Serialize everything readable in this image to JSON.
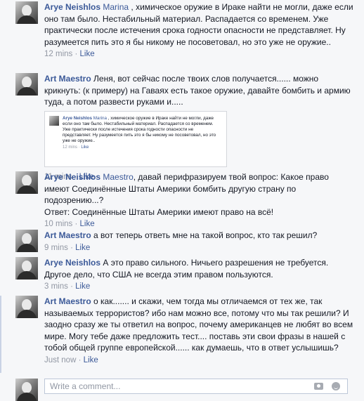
{
  "comments": [
    {
      "author": "Arye Neishlos",
      "mention": "Marina",
      "text": " , химическое оружие в Ираке найти не могли, даже если оно там было. Нестабильный материал. Распадается со временем. Уже практически после истечения срока годности опасности не представляет. Ну разумеется пить это я бы никому не посоветовал, но это уже не оружие..",
      "time": "12 mins",
      "like": "Like"
    },
    {
      "author": "Art Maestro",
      "mention": "",
      "text": " Леня, вот сейчас после твоих слов получается...... можно крикнуть: (к примеру) на Гаваях есть такое оружие, давайте бомбить и армию туда, а потом развести руками и.....",
      "time": "11 mins",
      "like": "Like",
      "attachment": {
        "author": "Arye Neishlos",
        "mention": "Marina",
        "text": " , химическое оружие в Ираке найти не могли, даже если оно там было. Нестабильный материал. Распадается со временем. Уже практически после истечения срока годности опасности не представляет. Ну разумеется пить это я бы никому не посоветовал, но это уже не оружие..",
        "time": "12 mins",
        "like": "Like"
      }
    },
    {
      "author": "Arye Neishlos",
      "mention": "Maestro",
      "text": ", давай перифразируем твой вопрос: Какое право имеют Соединённые Штаты Америки бомбить другую страну по подозрению...?",
      "text2": "Ответ: Соединённые Штаты Америки имеют право на всё!",
      "time": "10 mins",
      "like": "Like"
    },
    {
      "author": "Art Maestro",
      "mention": "",
      "text": " а вот теперь ответь мне на такой вопрос, кто так решил?",
      "time": "9 mins",
      "like": "Like"
    },
    {
      "author": "Arye Neishlos",
      "mention": "",
      "text": " А это право сильного. Ничьего разрешения не требуется. Другое дело, что США не всегда этим правом пользуются.",
      "time": "3 mins",
      "like": "Like"
    },
    {
      "author": "Art Maestro",
      "mention": "",
      "text": " о как....... и скажи, чем тогда мы отличаемся от тех же, так называемых террористов? ибо нам можно все, потому что мы так решили? И заодно сразу же ты ответил на вопрос, почему американцев не любят во всем мире. Могу тебе даже предложить тест.... поставь эти свои фразы в нашей с тобой общей группе европейской...... как думаешь, что в ответ услышишь?",
      "time": "Just now",
      "like": "Like"
    }
  ],
  "composer": {
    "placeholder": "Write a comment..."
  },
  "separator": "·"
}
